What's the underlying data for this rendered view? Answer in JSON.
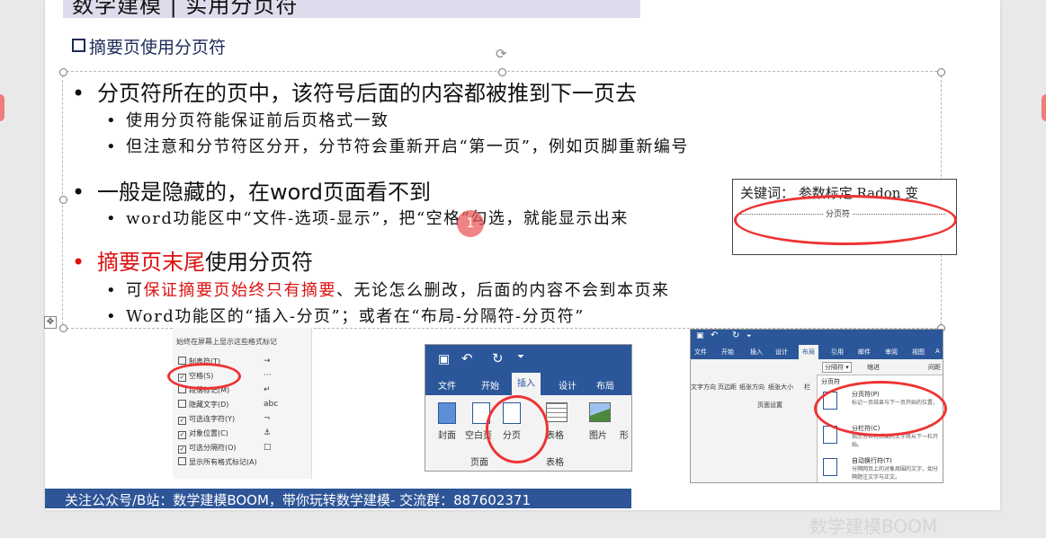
{
  "slide": {
    "title": "数学建模 | 实用分页符",
    "section_heading": "摘要页使用分页符"
  },
  "bullets": [
    {
      "text": "分页符所在的页中，该符号后面的内容都被推到下一页去",
      "subs": [
        "使用分页符能保证前后页格式一致",
        "但注意和分节符区分开，分节符会重新开启“第一页”，例如页脚重新编号"
      ]
    },
    {
      "text": "一般是隐藏的，在word页面看不到",
      "subs": [
        "word功能区中“文件-选项-显示”，把“空格”勾选，就能显示出来"
      ]
    },
    {
      "text_red": "摘要页末尾",
      "text_rest": "使用分页符",
      "sub1_prefix": "可",
      "sub1_red": "保证摘要页始终只有摘要",
      "sub1_rest": "、无论怎么删改，后面的内容不会到本页来",
      "sub2": "Word功能区的“插入-分页”；或者在“布局-分隔符-分页符”"
    }
  ],
  "cursor_label": "1",
  "keyword_box": {
    "line": "关键词：  参数标定  Radon 变",
    "page_break_label": "分页符"
  },
  "options_panel": {
    "heading": "始终在屏幕上显示这些格式标记",
    "items": [
      {
        "label": "制表符(T)",
        "symbol": "→"
      },
      {
        "label": "空格(S)",
        "symbol": "···"
      },
      {
        "label": "段落标记(M)",
        "symbol": "↵"
      },
      {
        "label": "隐藏文字(D)",
        "symbol": "abc"
      },
      {
        "label": "可选连字符(Y)",
        "symbol": "¬"
      },
      {
        "label": "对象位置(C)",
        "symbol": "⚓"
      },
      {
        "label": "可选分隔符(O)",
        "symbol": "□"
      },
      {
        "label": "显示所有格式标记(A)",
        "symbol": ""
      }
    ]
  },
  "word_insert": {
    "tabs": [
      "文件",
      "开始",
      "插入",
      "设计",
      "布局"
    ],
    "buttons": [
      "封面",
      "空白页",
      "分页",
      "表格",
      "图片",
      "形"
    ],
    "groups": [
      "页面",
      "表格"
    ]
  },
  "word_layout": {
    "tabs": [
      "文件",
      "开始",
      "插入",
      "设计",
      "布局",
      "引用",
      "邮件",
      "审阅",
      "视图",
      "A"
    ],
    "buttons": [
      "文字方向",
      "页边距",
      "纸张方向",
      "纸张大小",
      "栏"
    ],
    "separator_dropdown": "分隔符",
    "indent_label": "缩进",
    "spacing_label": "间距",
    "group_label": "页面设置",
    "menu_header": "分页符",
    "menu_items": [
      {
        "title": "分页符(P)",
        "desc": "标记一页结束与下一页开始的位置。"
      },
      {
        "title": "分栏符(C)",
        "desc": "指示分栏符后面的文字将从下一栏开始。"
      },
      {
        "title": "自动换行符(T)",
        "desc": "分隔网页上的对象周围的文字，如分隔题注文字与正文。"
      }
    ]
  },
  "footer": {
    "text": "关注公众号/B站：数学建模BOOM，带你玩转数学建模-  交流群：887602371"
  },
  "watermark": "数学建模BOOM"
}
